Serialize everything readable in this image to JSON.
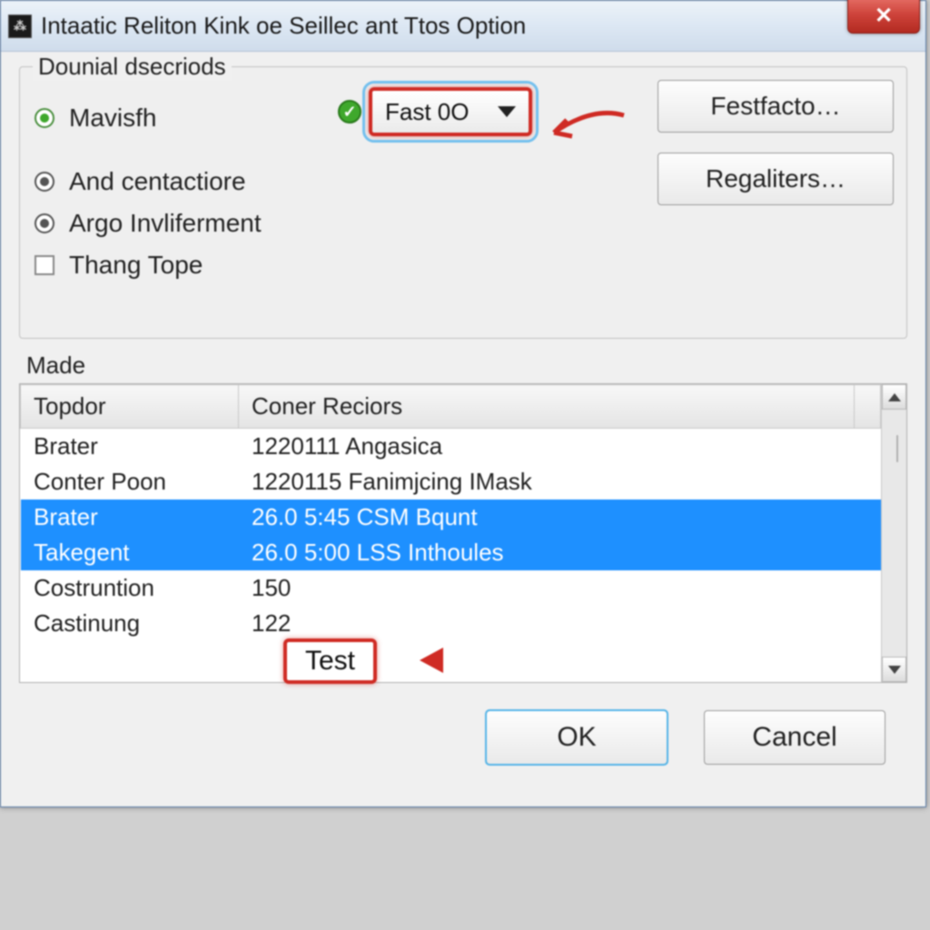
{
  "window": {
    "title": "Intaatic Reliton Kink oe Seillec ant Ttos Option"
  },
  "group": {
    "legend": "Dounial dsecriods",
    "options": [
      {
        "label": "Mavisfh",
        "type": "radio-green",
        "selected": true
      },
      {
        "label": "And centactiore",
        "type": "radio-gray",
        "selected": true
      },
      {
        "label": "Argo Invliferment",
        "type": "radio-gray",
        "selected": true
      },
      {
        "label": "Thang Tope",
        "type": "check",
        "selected": false
      }
    ],
    "dropdown": {
      "value": "Fast 0O"
    },
    "buttons": {
      "festfacto": "Festfacto…",
      "regaliters": "Regaliters…"
    }
  },
  "table": {
    "legend": "Made",
    "headers": [
      "Topdor",
      "Coner Reciors"
    ],
    "rows": [
      {
        "c0": "Brater",
        "c1": "1220111 Angasica",
        "selected": false
      },
      {
        "c0": "Conter Poon",
        "c1": "1220115  Fanimjcing IMask",
        "selected": false
      },
      {
        "c0": "Brater",
        "c1": "26.0 5:45 CSM Bqunt",
        "selected": true
      },
      {
        "c0": "Takegent",
        "c1": "26.0 5:00 LSS Inthoules",
        "selected": true
      },
      {
        "c0": "Costruntion",
        "c1": "150",
        "selected": false
      },
      {
        "c0": "Castinung",
        "c1": "122",
        "selected": false
      }
    ]
  },
  "callout": {
    "label": "Test"
  },
  "footer": {
    "ok": "OK",
    "cancel": "Cancel"
  },
  "colors": {
    "highlight_red": "#cf2b24",
    "selection_blue": "#1e90ff"
  }
}
